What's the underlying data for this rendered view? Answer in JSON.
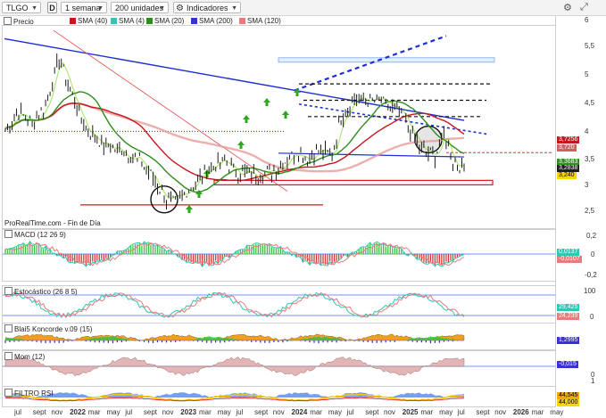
{
  "toolbar": {
    "ticker": "TLGO",
    "d_label": "D",
    "period": "1 semana",
    "units": "200 unidades",
    "indicators": "Indicadores"
  },
  "legend": [
    {
      "label": "Precio",
      "color": "#1d1d1d"
    },
    {
      "label": "SMA (40)",
      "color": "#c8171c"
    },
    {
      "label": "SMA (4)",
      "color": "#2ec8b4"
    },
    {
      "label": "SMA (20)",
      "color": "#2d8d1d"
    },
    {
      "label": "SMA (200)",
      "color": "#3a2fd8"
    },
    {
      "label": "SMA (120)",
      "color": "#e87b7b"
    }
  ],
  "source_label": "ProRealTime.com - Fin de Día",
  "panels": {
    "macd": {
      "label": "MACD (12 26 9)",
      "ticks": [
        "0,2",
        "0",
        "-0,2"
      ],
      "values": [
        "0,0137",
        "-0,0107"
      ]
    },
    "stoch": {
      "label": "Estocástico (26 8 5)",
      "ticks": [
        "100",
        "0"
      ],
      "values": [
        "29,425",
        "24,239"
      ]
    },
    "koncorde": {
      "label": "Blai5 Koncorde v.09 (15)",
      "values": [
        "1,2995"
      ]
    },
    "mom": {
      "label": "Mom (12)",
      "ticks": [
        "0"
      ],
      "values": [
        "-0,015"
      ]
    },
    "rsi": {
      "label": "FILTRO RSI",
      "ticks": [
        "1"
      ],
      "values": [
        "44,545",
        "44,000"
      ]
    }
  },
  "price_axis": {
    "ticks": [
      "6",
      "5,5",
      "5",
      "4,5",
      "4",
      "3,5",
      "3",
      "2,5"
    ],
    "labels": [
      {
        "text": "3,7256",
        "color": "#c8171c"
      },
      {
        "text": "3,720",
        "color": "#d06060"
      },
      {
        "text": "3,3683",
        "color": "#2d8d1d"
      },
      {
        "text": "3,2838",
        "color": "#1d1d1d"
      },
      {
        "text": "3,240",
        "color": "#1d1d1d"
      }
    ]
  },
  "time_axis": [
    "jul",
    "sept",
    "nov",
    "2022",
    "mar",
    "may",
    "jul",
    "sept",
    "nov",
    "2023",
    "mar",
    "may",
    "jul",
    "sept",
    "nov",
    "2024",
    "mar",
    "may",
    "jul",
    "sept",
    "nov",
    "2025",
    "mar",
    "may",
    "jul",
    "sept",
    "nov",
    "2026",
    "mar",
    "may"
  ],
  "colors": {
    "trend_blue": "#1b2fd6",
    "support_red": "#e0141c",
    "sma40": "#c8171c",
    "sma20": "#2d8d1d",
    "sma4": "#2ec8b4",
    "arrow_green": "#2fa81f"
  }
}
